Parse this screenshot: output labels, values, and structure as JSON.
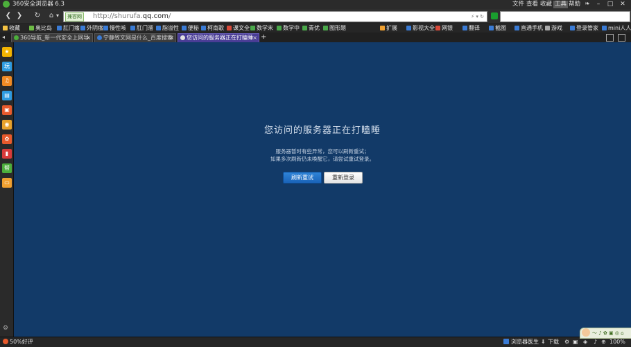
{
  "window": {
    "title": "360安全浏览器 6.3"
  },
  "menu": [
    "文件",
    "查看",
    "收藏",
    "工具",
    "帮助"
  ],
  "active_menu": "工具",
  "window_controls": {
    "skin": "❧",
    "minimize": "–",
    "maximize": "□",
    "close": "✕"
  },
  "nav": {
    "back": "❮",
    "forward": "❯",
    "refresh": "↻",
    "home": "⌂",
    "home_dropdown": "▾",
    "mode_badge": "兼容网",
    "url_prefix": "http://shurufa.",
    "url_domain": "qq.com",
    "url_suffix": "/",
    "address_icons": "⚡ ▾ ↻",
    "search_placeholder": ""
  },
  "bookmarks": [
    {
      "label": "收藏",
      "color": "#f5c242"
    },
    {
      "label": "奥比岛",
      "color": "#6dbb45"
    },
    {
      "label": "肛门瘙",
      "color": "#3a7bd5"
    },
    {
      "label": "外阴瘙",
      "color": "#3a7bd5"
    },
    {
      "label": "慢性咳",
      "color": "#3a7bd5"
    },
    {
      "label": "肛门溜",
      "color": "#3a7bd5"
    },
    {
      "label": "脂溢性",
      "color": "#3a7bd5"
    },
    {
      "label": "便秘",
      "color": "#3a7bd5"
    },
    {
      "label": "柯南歌",
      "color": "#3a7bd5"
    },
    {
      "label": "课文全",
      "color": "#d94a3a"
    },
    {
      "label": "数学末",
      "color": "#4aa84a"
    },
    {
      "label": "数学中",
      "color": "#4aa84a"
    },
    {
      "label": "青优",
      "color": "#4aa84a"
    },
    {
      "label": "图形题",
      "color": "#4aa84a"
    },
    {
      "label": "扩展",
      "color": "#f0a030"
    },
    {
      "label": "影视大全",
      "color": "#3a7bd5"
    },
    {
      "label": "网银",
      "color": "#d94a3a"
    },
    {
      "label": "翻译",
      "color": "#3a7bd5"
    },
    {
      "label": "截图",
      "color": "#3a7bd5"
    },
    {
      "label": "直通手机",
      "color": "#3a7bd5"
    },
    {
      "label": "游戏",
      "color": "#aaaaaa"
    },
    {
      "label": "登录管家",
      "color": "#3a7bd5"
    },
    {
      "label": "mini人人",
      "color": "#3a7bd5"
    }
  ],
  "tabs": [
    {
      "label": "360导航_新一代安全上网导",
      "active": false,
      "color": "#4caf3b"
    },
    {
      "label": "宁静致文网是什么_百度搜索",
      "active": false,
      "color": "#3a7bd5"
    },
    {
      "label": "您访问的服务器正在打瞌睡",
      "active": true,
      "color": "#e0e0e0"
    }
  ],
  "tab_close": "×",
  "new_tab": "+",
  "tab_list": "◂",
  "sidebar_icons": [
    {
      "name": "favorite-star-icon",
      "glyph": "★",
      "color": "#f4b400"
    },
    {
      "name": "games-icon",
      "glyph": "玩",
      "color": "#2e9be0"
    },
    {
      "name": "music-icon",
      "glyph": "♫",
      "color": "#f08a24"
    },
    {
      "name": "reading-icon",
      "glyph": "▤",
      "color": "#2e9be0"
    },
    {
      "name": "shopping-icon",
      "glyph": "▣",
      "color": "#e85a2c"
    },
    {
      "name": "weibo-icon",
      "glyph": "◉",
      "color": "#e8a22c"
    },
    {
      "name": "app-center-icon",
      "glyph": "✿",
      "color": "#e85a2c"
    },
    {
      "name": "mobile-icon",
      "glyph": "▮",
      "color": "#d93a3a"
    },
    {
      "name": "help-icon",
      "glyph": "帮",
      "color": "#4cae3b"
    },
    {
      "name": "folder-icon",
      "glyph": "▭",
      "color": "#f0a030"
    }
  ],
  "error": {
    "title": "您访问的服务器正在打瞌睡",
    "line1": "服务器暂时有些异常，您可以刷新重试；",
    "line2": "如果多次刷新仍未唤醒它，请尝试重试登录。",
    "refresh_button": "刷新重试",
    "relogin_button": "重新登录"
  },
  "status": {
    "rating": "50%好评",
    "doctor": "浏览器医生",
    "download": "下载",
    "zoom": "100%",
    "mascot_text": "〜 ♪ ✿ ▣ ◎ ⌂"
  }
}
